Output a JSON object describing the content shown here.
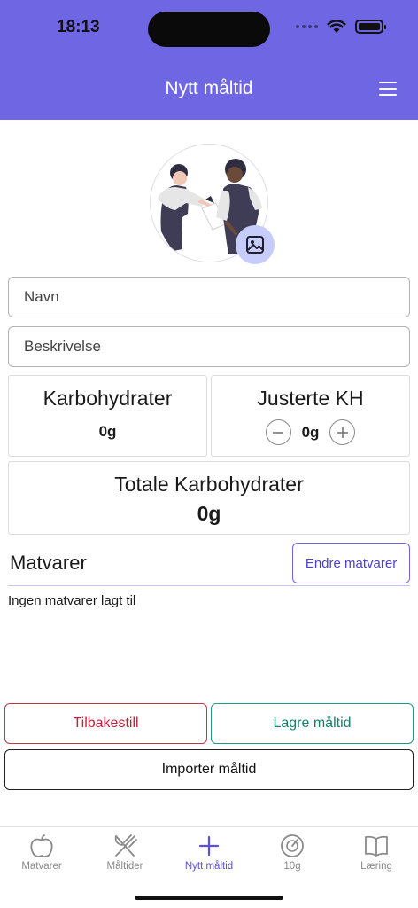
{
  "status_bar": {
    "time": "18:13"
  },
  "header": {
    "title": "Nytt måltid",
    "menu_icon": "hamburger-menu-icon"
  },
  "form": {
    "name_placeholder": "Navn",
    "description_placeholder": "Beskrivelse"
  },
  "carbs": {
    "title": "Karbohydrater",
    "value": "0g"
  },
  "adjusted": {
    "title": "Justerte KH",
    "value": "0g"
  },
  "total": {
    "title": "Totale Karbohydrater",
    "value": "0g"
  },
  "foods": {
    "title": "Matvarer",
    "edit_label": "Endre matvarer",
    "empty_text": "Ingen matvarer lagt til"
  },
  "actions": {
    "reset_label": "Tilbakestill",
    "save_label": "Lagre måltid",
    "import_label": "Importer måltid"
  },
  "tabbar": {
    "items": [
      {
        "label": "Matvarer",
        "icon": "apple-icon"
      },
      {
        "label": "Måltider",
        "icon": "fork-knife-icon"
      },
      {
        "label": "Nytt måltid",
        "icon": "plus-icon",
        "active": true
      },
      {
        "label": "10g",
        "icon": "gauge-icon"
      },
      {
        "label": "Læring",
        "icon": "book-icon"
      }
    ]
  },
  "colors": {
    "accent": "#6f66e3",
    "reset": "#c1203a",
    "save": "#13806e"
  }
}
